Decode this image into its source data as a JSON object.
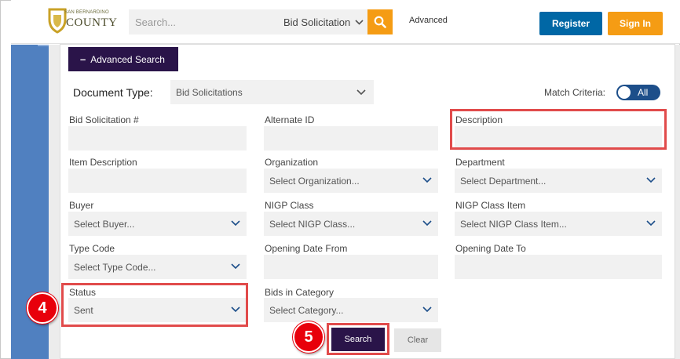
{
  "header": {
    "logo_small": "SAN BERNARDINO",
    "logo_big": "COUNTY",
    "search_placeholder": "Search...",
    "search_type": "Bid Solicitation",
    "advanced_label": "Advanced",
    "register_label": "Register",
    "signin_label": "Sign In"
  },
  "advanced_search": {
    "tab_label": "Advanced Search",
    "document_type_label": "Document Type:",
    "document_type_value": "Bid Solicitations",
    "match_criteria_label": "Match Criteria:",
    "match_criteria_value": "All",
    "fields": {
      "bid_solicitation": {
        "label": "Bid Solicitation #",
        "value": ""
      },
      "alternate_id": {
        "label": "Alternate ID",
        "value": ""
      },
      "description": {
        "label": "Description",
        "value": ""
      },
      "item_description": {
        "label": "Item Description",
        "value": ""
      },
      "organization": {
        "label": "Organization",
        "value": "Select Organization..."
      },
      "department": {
        "label": "Department",
        "value": "Select Department..."
      },
      "buyer": {
        "label": "Buyer",
        "value": "Select Buyer..."
      },
      "nigp_class": {
        "label": "NIGP Class",
        "value": "Select NIGP Class..."
      },
      "nigp_class_item": {
        "label": "NIGP Class Item",
        "value": "Select NIGP Class Item..."
      },
      "type_code": {
        "label": "Type Code",
        "value": "Select Type Code..."
      },
      "opening_date_from": {
        "label": "Opening Date From",
        "value": ""
      },
      "opening_date_to": {
        "label": "Opening Date To",
        "value": ""
      },
      "status": {
        "label": "Status",
        "value": "Sent"
      },
      "bids_in_category": {
        "label": "Bids in Category",
        "value": "Select Category..."
      }
    },
    "search_label": "Search",
    "clear_label": "Clear"
  },
  "annotations": {
    "step_4": "4",
    "step_5": "5"
  },
  "colors": {
    "brand_blue": "#0067a5",
    "brand_orange": "#f59c14",
    "dark_purple": "#2a1449",
    "highlight_red": "#e14b4b",
    "badge_red": "#e8000b"
  }
}
